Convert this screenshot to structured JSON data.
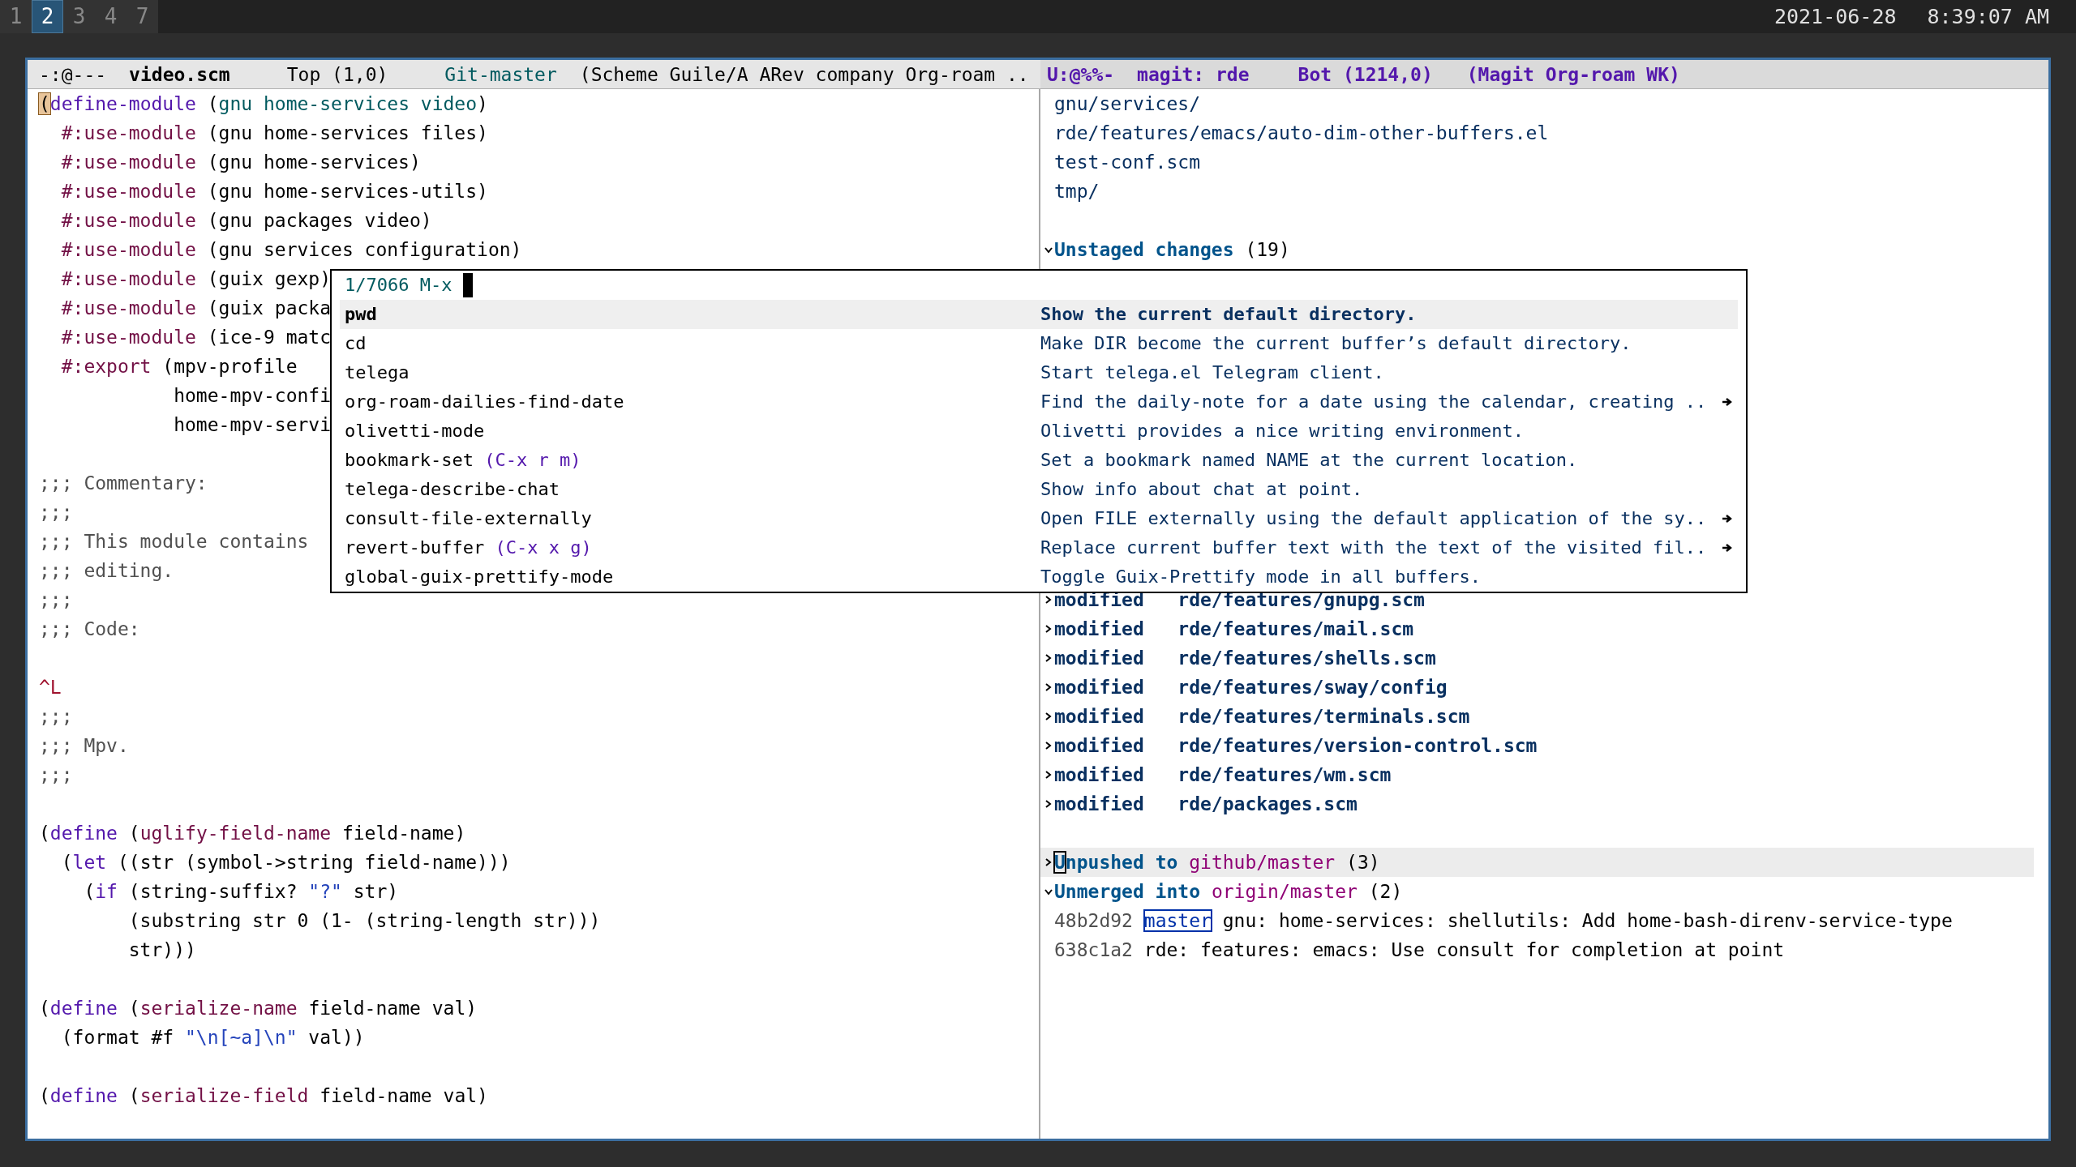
{
  "top_bar": {
    "workspaces": [
      {
        "label": "1",
        "selected": false
      },
      {
        "label": "2",
        "selected": true
      },
      {
        "label": "3",
        "selected": false
      },
      {
        "label": "4",
        "selected": false
      },
      {
        "label": "7",
        "selected": false
      }
    ],
    "date": "2021-06-28",
    "time": "8:39:07 AM"
  },
  "left_window": {
    "mode_line": [
      {
        "text": "-:@---",
        "kind": "plain"
      },
      {
        "text": "video.scm",
        "kind": "bold"
      },
      {
        "text": "Top (1,0)",
        "kind": "plain"
      },
      {
        "text": "Git-master",
        "kind": "teal"
      },
      {
        "text": "(Scheme Guile/A ARev company Org-roam ..",
        "kind": "plain"
      }
    ],
    "lines": [
      {
        "kind": "code",
        "segments": [
          {
            "text": "(",
            "kind": "cursor"
          },
          {
            "text": "define-module",
            "kind": "builtin"
          },
          {
            "text": " (",
            "kind": "plain"
          },
          {
            "text": "gnu home-services video",
            "kind": "module"
          },
          {
            "text": ")",
            "kind": "plain"
          }
        ]
      },
      {
        "kind": "code",
        "segments": [
          {
            "text": "  #:use-module",
            "kind": "keyword"
          },
          {
            "text": " (gnu home-services files)",
            "kind": "plain"
          }
        ]
      },
      {
        "kind": "code",
        "segments": [
          {
            "text": "  #:use-module",
            "kind": "keyword"
          },
          {
            "text": " (gnu home-services)",
            "kind": "plain"
          }
        ]
      },
      {
        "kind": "code",
        "segments": [
          {
            "text": "  #:use-module",
            "kind": "keyword"
          },
          {
            "text": " (gnu home-services-utils)",
            "kind": "plain"
          }
        ]
      },
      {
        "kind": "code",
        "segments": [
          {
            "text": "  #:use-module",
            "kind": "keyword"
          },
          {
            "text": " (gnu packages video)",
            "kind": "plain"
          }
        ]
      },
      {
        "kind": "code",
        "segments": [
          {
            "text": "  #:use-module",
            "kind": "keyword"
          },
          {
            "text": " (gnu services configuration)",
            "kind": "plain"
          }
        ]
      },
      {
        "kind": "code",
        "segments": [
          {
            "text": "  #:use-module",
            "kind": "keyword"
          },
          {
            "text": " (guix gexp)",
            "kind": "plain"
          }
        ]
      },
      {
        "kind": "code",
        "segments": [
          {
            "text": "  #:use-module",
            "kind": "keyword"
          },
          {
            "text": " (guix packa",
            "kind": "plain"
          }
        ]
      },
      {
        "kind": "code",
        "segments": [
          {
            "text": "  #:use-module",
            "kind": "keyword"
          },
          {
            "text": " (ice-9 matc",
            "kind": "plain"
          }
        ]
      },
      {
        "kind": "code",
        "segments": [
          {
            "text": "  #:export",
            "kind": "keyword"
          },
          {
            "text": " (mpv-profile",
            "kind": "plain"
          }
        ]
      },
      {
        "kind": "code",
        "segments": [
          {
            "text": "            home-mpv-confi",
            "kind": "plain"
          }
        ]
      },
      {
        "kind": "code",
        "segments": [
          {
            "text": "            home-mpv-servi",
            "kind": "plain"
          }
        ]
      },
      {
        "kind": "blank"
      },
      {
        "kind": "code",
        "segments": [
          {
            "text": ";;; Commentary:",
            "kind": "comment"
          }
        ]
      },
      {
        "kind": "code",
        "segments": [
          {
            "text": ";;;",
            "kind": "comment"
          }
        ]
      },
      {
        "kind": "code",
        "segments": [
          {
            "text": ";;; This module contains",
            "kind": "comment"
          }
        ]
      },
      {
        "kind": "code",
        "segments": [
          {
            "text": ";;; editing.",
            "kind": "comment"
          }
        ]
      },
      {
        "kind": "code",
        "segments": [
          {
            "text": ";;;",
            "kind": "comment"
          }
        ]
      },
      {
        "kind": "code",
        "segments": [
          {
            "text": ";;; Code:",
            "kind": "comment"
          }
        ]
      },
      {
        "kind": "blank"
      },
      {
        "kind": "code",
        "segments": [
          {
            "text": "^L",
            "kind": "pagebreak"
          }
        ]
      },
      {
        "kind": "code",
        "segments": [
          {
            "text": ";;;",
            "kind": "comment"
          }
        ]
      },
      {
        "kind": "code",
        "segments": [
          {
            "text": ";;; Mpv.",
            "kind": "comment"
          }
        ]
      },
      {
        "kind": "code",
        "segments": [
          {
            "text": ";;;",
            "kind": "comment"
          }
        ]
      },
      {
        "kind": "blank"
      },
      {
        "kind": "code",
        "segments": [
          {
            "text": "(",
            "kind": "plain"
          },
          {
            "text": "define",
            "kind": "builtin"
          },
          {
            "text": " (",
            "kind": "plain"
          },
          {
            "text": "uglify-field-name",
            "kind": "function"
          },
          {
            "text": " field-name)",
            "kind": "plain"
          }
        ]
      },
      {
        "kind": "code",
        "segments": [
          {
            "text": "  (",
            "kind": "plain"
          },
          {
            "text": "let",
            "kind": "builtin"
          },
          {
            "text": " ((str (symbol->string field-name)))",
            "kind": "plain"
          }
        ]
      },
      {
        "kind": "code",
        "segments": [
          {
            "text": "    (",
            "kind": "plain"
          },
          {
            "text": "if",
            "kind": "builtin"
          },
          {
            "text": " (string-suffix? ",
            "kind": "plain"
          },
          {
            "text": "\"?\"",
            "kind": "string"
          },
          {
            "text": " str)",
            "kind": "plain"
          }
        ]
      },
      {
        "kind": "code",
        "segments": [
          {
            "text": "        (substring str 0 (1- (string-length str)))",
            "kind": "plain"
          }
        ]
      },
      {
        "kind": "code",
        "segments": [
          {
            "text": "        str)))",
            "kind": "plain"
          }
        ]
      },
      {
        "kind": "blank"
      },
      {
        "kind": "code",
        "segments": [
          {
            "text": "(",
            "kind": "plain"
          },
          {
            "text": "define",
            "kind": "builtin"
          },
          {
            "text": " (",
            "kind": "plain"
          },
          {
            "text": "serialize-name",
            "kind": "function"
          },
          {
            "text": " field-name val)",
            "kind": "plain"
          }
        ]
      },
      {
        "kind": "code",
        "segments": [
          {
            "text": "  (format #f ",
            "kind": "plain"
          },
          {
            "text": "\"\\n[~a]\\n\"",
            "kind": "string"
          },
          {
            "text": " val))",
            "kind": "plain"
          }
        ]
      },
      {
        "kind": "blank"
      },
      {
        "kind": "code",
        "segments": [
          {
            "text": "(",
            "kind": "plain"
          },
          {
            "text": "define",
            "kind": "builtin"
          },
          {
            "text": " (",
            "kind": "plain"
          },
          {
            "text": "serialize-field",
            "kind": "function"
          },
          {
            "text": " field-name val)",
            "kind": "plain"
          }
        ]
      }
    ]
  },
  "right_window": {
    "mode_line": [
      {
        "text": "U:@%%-",
        "kind": "purple"
      },
      {
        "text": "magit: rde",
        "kind": "purple"
      },
      {
        "text": "Bot (1214,0)",
        "kind": "purple"
      },
      {
        "text": "(Magit Org-roam WK)",
        "kind": "purple"
      }
    ],
    "upper_lines": [
      {
        "kind": "text",
        "segments": [
          {
            "text": "gnu/services/",
            "kind": "file"
          }
        ]
      },
      {
        "kind": "text",
        "segments": [
          {
            "text": "rde/features/emacs/auto-dim-other-buffers.el",
            "kind": "file"
          }
        ]
      },
      {
        "kind": "text",
        "segments": [
          {
            "text": "test-conf.scm",
            "kind": "file"
          }
        ]
      },
      {
        "kind": "text",
        "segments": [
          {
            "text": "tmp/",
            "kind": "file"
          }
        ]
      },
      {
        "kind": "blank"
      },
      {
        "kind": "section",
        "expanded": true,
        "current": false,
        "segments": [
          {
            "text": "Unstaged changes",
            "kind": "heading"
          },
          {
            "text": " (19)",
            "kind": "plain"
          }
        ]
      }
    ],
    "lower_lines": [
      {
        "kind": "section",
        "expanded": false,
        "current": false,
        "segments": [
          {
            "text": "modified   rde/features/gnupg.scm",
            "kind": "path"
          }
        ]
      },
      {
        "kind": "section",
        "expanded": false,
        "current": false,
        "segments": [
          {
            "text": "modified   rde/features/mail.scm",
            "kind": "path"
          }
        ]
      },
      {
        "kind": "section",
        "expanded": false,
        "current": false,
        "segments": [
          {
            "text": "modified   rde/features/shells.scm",
            "kind": "path"
          }
        ]
      },
      {
        "kind": "section",
        "expanded": false,
        "current": false,
        "segments": [
          {
            "text": "modified   rde/features/sway/config",
            "kind": "path"
          }
        ]
      },
      {
        "kind": "section",
        "expanded": false,
        "current": false,
        "segments": [
          {
            "text": "modified   rde/features/terminals.scm",
            "kind": "path"
          }
        ]
      },
      {
        "kind": "section",
        "expanded": false,
        "current": false,
        "segments": [
          {
            "text": "modified   rde/features/version-control.scm",
            "kind": "path"
          }
        ]
      },
      {
        "kind": "section",
        "expanded": false,
        "current": false,
        "segments": [
          {
            "text": "modified   rde/features/wm.scm",
            "kind": "path"
          }
        ]
      },
      {
        "kind": "section",
        "expanded": false,
        "current": false,
        "segments": [
          {
            "text": "modified   rde/packages.scm",
            "kind": "path"
          }
        ]
      },
      {
        "kind": "blank"
      },
      {
        "kind": "section",
        "expanded": false,
        "current": true,
        "segments": [
          {
            "text": "U",
            "kind": "heading_cursor"
          },
          {
            "text": "npushed to ",
            "kind": "heading"
          },
          {
            "text": "github/master",
            "kind": "remote"
          },
          {
            "text": " (3)",
            "kind": "plain"
          }
        ]
      },
      {
        "kind": "section",
        "expanded": true,
        "current": false,
        "segments": [
          {
            "text": "Unmerged into ",
            "kind": "heading"
          },
          {
            "text": "origin/master",
            "kind": "remote"
          },
          {
            "text": " (2)",
            "kind": "plain"
          }
        ]
      },
      {
        "kind": "text",
        "segments": [
          {
            "text": "48b2d92 ",
            "kind": "hash"
          },
          {
            "text": "master",
            "kind": "branch"
          },
          {
            "text": " gnu: home-services: shellutils: Add home-bash-direnv-service-type",
            "kind": "plain"
          }
        ]
      },
      {
        "kind": "text",
        "segments": [
          {
            "text": "638c1a2",
            "kind": "hash"
          },
          {
            "text": " rde: features: emacs: Use consult for completion at point",
            "kind": "plain"
          }
        ]
      }
    ]
  },
  "minibuffer": {
    "count": "1/7066",
    "prompt": "M-x",
    "candidates": [
      {
        "name": "pwd",
        "description": "Show the current default directory.",
        "selected": true,
        "truncated": false
      },
      {
        "name": "cd",
        "description": "Make DIR become the current buffer’s default directory.",
        "selected": false,
        "truncated": false
      },
      {
        "name": "telega",
        "description": "Start telega.el Telegram client.",
        "selected": false,
        "truncated": false
      },
      {
        "name": "org-roam-dailies-find-date",
        "description": "Find the daily-note for a date using the calendar, creating ..",
        "selected": false,
        "truncated": true
      },
      {
        "name": "olivetti-mode",
        "description": "Olivetti provides a nice writing environment.",
        "selected": false,
        "truncated": false
      },
      {
        "name": "bookmark-set",
        "keybinding": "(C-x r m)",
        "description": "Set a bookmark named NAME at the current location.",
        "selected": false,
        "truncated": false
      },
      {
        "name": "telega-describe-chat",
        "description": "Show info about chat at point.",
        "selected": false,
        "truncated": false
      },
      {
        "name": "consult-file-externally",
        "description": "Open FILE externally using the default application of the sy..",
        "selected": false,
        "truncated": true
      },
      {
        "name": "revert-buffer",
        "keybinding": "(C-x x g)",
        "description": "Replace current buffer text with the text of the visited fil..",
        "selected": false,
        "truncated": true
      },
      {
        "name": "global-guix-prettify-mode",
        "description": "Toggle Guix-Prettify mode in all buffers.",
        "selected": false,
        "truncated": false
      }
    ]
  }
}
